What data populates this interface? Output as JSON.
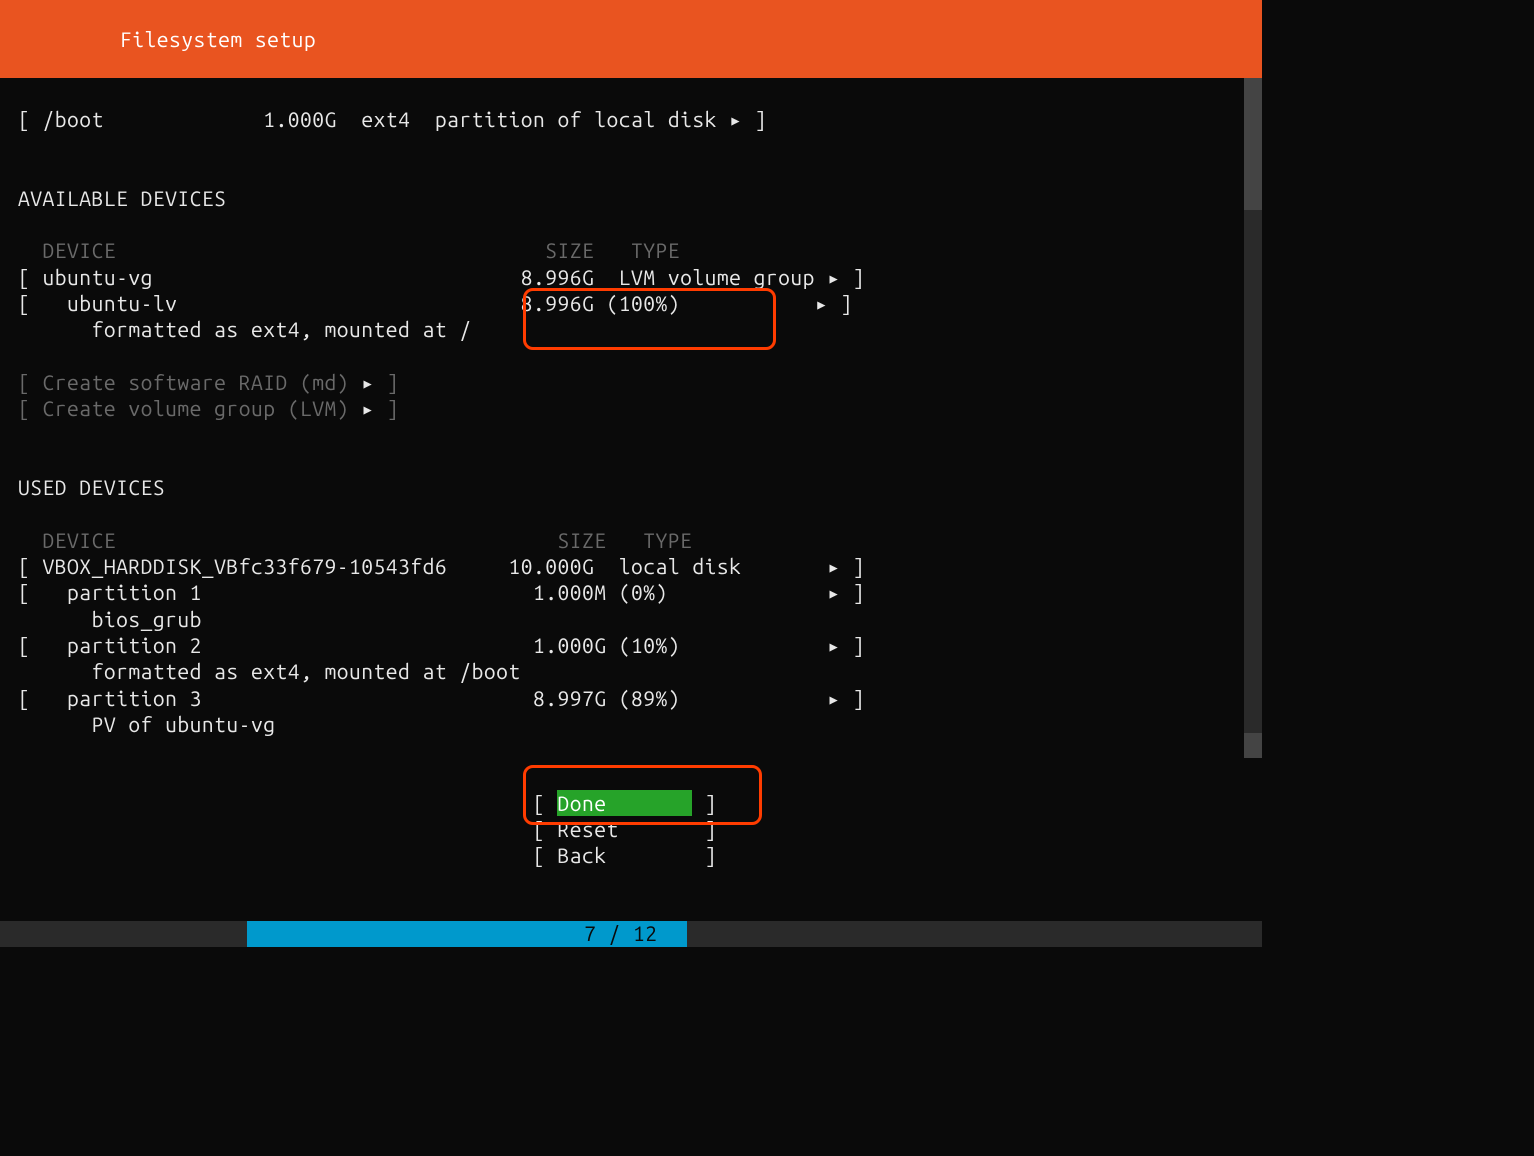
{
  "header": {
    "title": "Filesystem setup"
  },
  "boot_partition": {
    "mount": "/boot",
    "size": "1.000G",
    "fs": "ext4",
    "desc": "partition of local disk"
  },
  "available_devices": {
    "heading": "AVAILABLE DEVICES",
    "col_device": "DEVICE",
    "col_size": "SIZE",
    "col_type": "TYPE",
    "vg": {
      "name": "ubuntu-vg",
      "size": "8.996G",
      "type": "LVM volume group"
    },
    "lv": {
      "name": "ubuntu-lv",
      "size": "8.996G",
      "percent": "(100%)",
      "detail": "formatted as ext4, mounted at /"
    },
    "create_raid": "Create software RAID (md)",
    "create_lvm": "Create volume group (LVM)"
  },
  "used_devices": {
    "heading": "USED DEVICES",
    "col_device": "DEVICE",
    "col_size": "SIZE",
    "col_type": "TYPE",
    "disk": {
      "name": "VBOX_HARDDISK_VBfc33f679-10543fd6",
      "size": "10.000G",
      "type": "local disk"
    },
    "p1": {
      "name": "partition 1",
      "size": "1.000M",
      "percent": "(0%)",
      "detail": "bios_grub"
    },
    "p2": {
      "name": "partition 2",
      "size": "1.000G",
      "percent": "(10%)",
      "detail": "formatted as ext4, mounted at /boot"
    },
    "p3": {
      "name": "partition 3",
      "size": "8.997G",
      "percent": "(89%)",
      "detail": "PV of ubuntu-vg"
    }
  },
  "buttons": {
    "done": "Done",
    "reset": "Reset",
    "back": "Back"
  },
  "progress": {
    "text": "7 / 12"
  }
}
